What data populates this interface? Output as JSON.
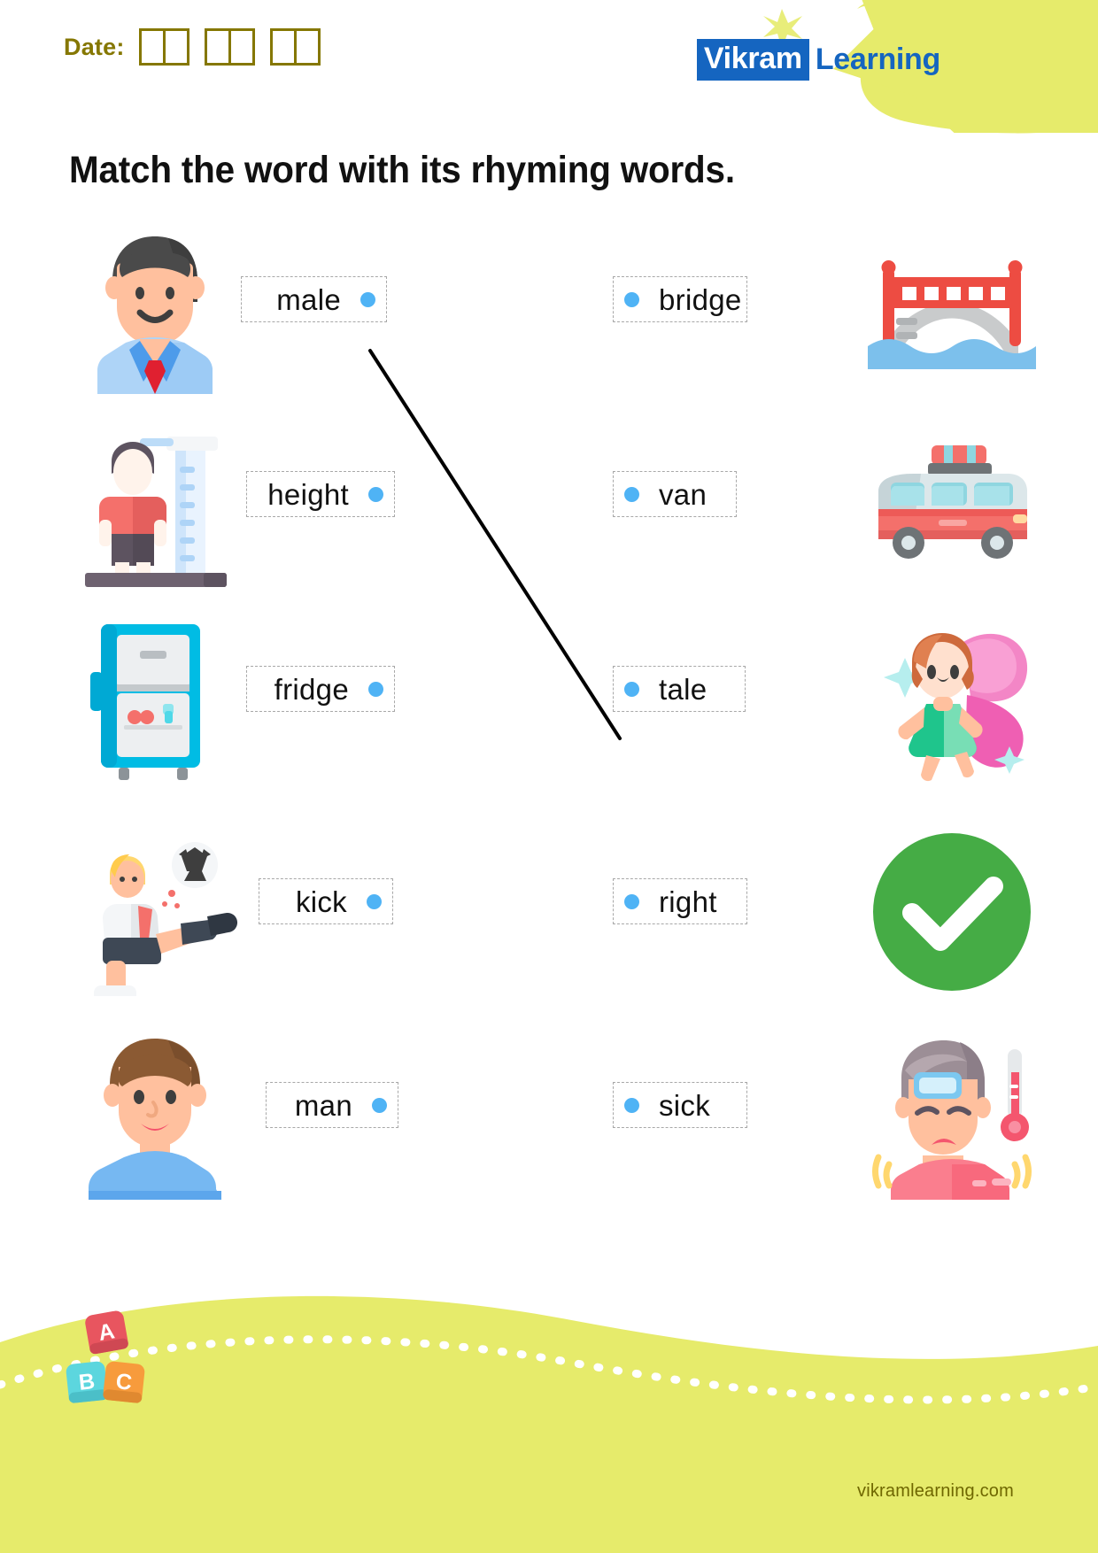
{
  "header": {
    "date_label": "Date:",
    "date_box_groups": 3,
    "date_boxes_per_group": 2,
    "logo_brand": "Vikram",
    "logo_word": "Learning",
    "logo_blob_color": "#E6EB6B",
    "logo_brand_bg": "#1565C0",
    "logo_word_color": "#1565C0"
  },
  "title": "Match the word with its rhyming words.",
  "colors": {
    "dot": "#4FB3F5",
    "dashed_border": "#a8a8a8",
    "date_ink": "#857700",
    "footer_band": "#E6EB6B",
    "footer_text": "#6f6700",
    "connector_line": "#000000"
  },
  "left_column": [
    {
      "word": "male",
      "image": "man-in-shirt-and-tie-icon"
    },
    {
      "word": "height",
      "image": "child-height-measure-icon"
    },
    {
      "word": "fridge",
      "image": "refrigerator-icon"
    },
    {
      "word": "kick",
      "image": "soccer-player-kicking-icon"
    },
    {
      "word": "man",
      "image": "young-man-portrait-icon"
    }
  ],
  "right_column": [
    {
      "word": "bridge",
      "image": "red-bridge-over-water-icon"
    },
    {
      "word": "van",
      "image": "red-camper-van-icon"
    },
    {
      "word": "tale",
      "image": "fairy-with-pink-wings-icon"
    },
    {
      "word": "right",
      "image": "green-check-circle-icon"
    },
    {
      "word": "sick",
      "image": "sick-person-with-thermometer-icon"
    }
  ],
  "connections": [
    {
      "from": "male",
      "to": "tale"
    }
  ],
  "footer": {
    "url": "vikramlearning.com",
    "blocks": [
      {
        "letter": "A",
        "color": "#E8555F"
      },
      {
        "letter": "B",
        "color": "#5CD6DE"
      },
      {
        "letter": "C",
        "color": "#F79B3C"
      }
    ]
  }
}
